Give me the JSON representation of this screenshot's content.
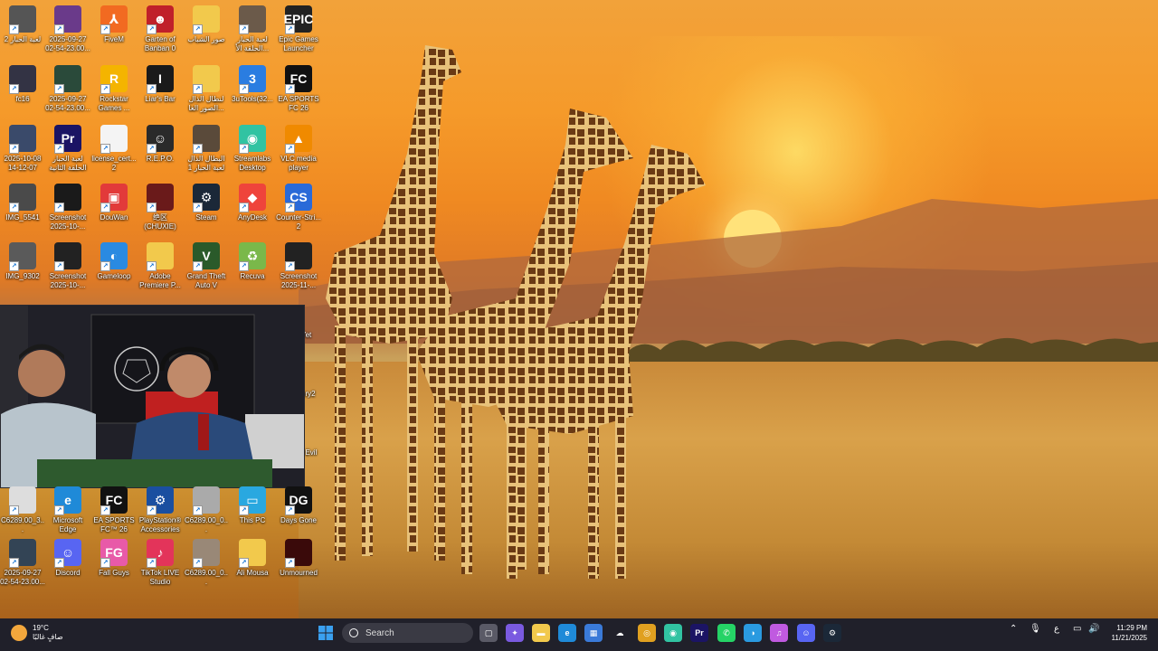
{
  "desktop": {
    "icons": [
      {
        "label": "لعبة الحبار 2",
        "icon": "video-thumbnail-icon",
        "color": "#555555",
        "glyph": ""
      },
      {
        "label": "2025-09-27 02-54-23.00...",
        "icon": "video-thumbnail-icon",
        "color": "#6a3a8a",
        "glyph": ""
      },
      {
        "label": "FiveM",
        "icon": "fivem-icon",
        "color": "#f26a21",
        "glyph": "⅄"
      },
      {
        "label": "Garten of Banban 0",
        "icon": "banban-game-icon",
        "color": "#c0202a",
        "glyph": "☻"
      },
      {
        "label": "صور الشباب",
        "icon": "folder-icon",
        "color": "#f2c94c",
        "glyph": ""
      },
      {
        "label": "لعبة الحبار الحلقة الأ...",
        "icon": "video-thumbnail-icon",
        "color": "#6b5a4a",
        "glyph": ""
      },
      {
        "label": "Epic Games Launcher",
        "icon": "epic-games-icon",
        "color": "#222222",
        "glyph": "EPIC"
      },
      {
        "label": "fc16",
        "icon": "video-thumbnail-icon",
        "color": "#333344",
        "glyph": ""
      },
      {
        "label": "2025-09-27 02-54-23.00...",
        "icon": "video-thumbnail-icon",
        "color": "#2a4a3a",
        "glyph": ""
      },
      {
        "label": "Rockstar Games ...",
        "icon": "rockstar-icon",
        "color": "#f4b400",
        "glyph": "R"
      },
      {
        "label": "Liar's Bar",
        "icon": "liars-bar-icon",
        "color": "#1a1a1a",
        "glyph": "I"
      },
      {
        "label": "لنطال الذال الصور الغا...",
        "icon": "folder-icon",
        "color": "#f2c94c",
        "glyph": ""
      },
      {
        "label": "3uTools(32...",
        "icon": "3utools-icon",
        "color": "#2a7de1",
        "glyph": "3"
      },
      {
        "label": "EA SPORTS FC 26",
        "icon": "ea-fc-icon",
        "color": "#111111",
        "glyph": "FC"
      },
      {
        "label": "2025-10-08 14-12-07",
        "icon": "video-thumbnail-icon",
        "color": "#3a4a6a",
        "glyph": ""
      },
      {
        "label": "لعبة الحبار الحلقة الثانية",
        "icon": "premiere-project-icon",
        "color": "#1b1464",
        "glyph": "Pr"
      },
      {
        "label": "license_cert... 2",
        "icon": "document-icon",
        "color": "#f4f4f4",
        "glyph": ""
      },
      {
        "label": "R.E.P.O.",
        "icon": "repo-game-icon",
        "color": "#2a2a2a",
        "glyph": "☺"
      },
      {
        "label": "البطال الذال لعبة الحبار 1",
        "icon": "video-thumbnail-icon",
        "color": "#5a4a3a",
        "glyph": ""
      },
      {
        "label": "Streamlabs Desktop",
        "icon": "streamlabs-icon",
        "color": "#31c3a2",
        "glyph": "◉"
      },
      {
        "label": "VLC media player",
        "icon": "vlc-icon",
        "color": "#f08a00",
        "glyph": "▲"
      },
      {
        "label": "IMG_5541",
        "icon": "photo-thumbnail-icon",
        "color": "#4a4a4a",
        "glyph": ""
      },
      {
        "label": "Screenshot 2025-10-...",
        "icon": "screenshot-thumbnail-icon",
        "color": "#1a1a1a",
        "glyph": ""
      },
      {
        "label": "DouWan",
        "icon": "douwan-icon",
        "color": "#e23a3a",
        "glyph": "▣"
      },
      {
        "label": "绝区 (CHUXIE)",
        "icon": "chuxie-game-icon",
        "color": "#6a1a1a",
        "glyph": ""
      },
      {
        "label": "Steam",
        "icon": "steam-icon",
        "color": "#1b2838",
        "glyph": "⚙"
      },
      {
        "label": "AnyDesk",
        "icon": "anydesk-icon",
        "color": "#ef443b",
        "glyph": "◆"
      },
      {
        "label": "Counter-Stri... 2",
        "icon": "counter-strike-icon",
        "color": "#2a6ad8",
        "glyph": "CS"
      },
      {
        "label": "IMG_9302",
        "icon": "photo-thumbnail-icon",
        "color": "#5a5a5a",
        "glyph": ""
      },
      {
        "label": "Screenshot 2025-10-...",
        "icon": "screenshot-thumbnail-icon",
        "color": "#222222",
        "glyph": ""
      },
      {
        "label": "Gameloop",
        "icon": "gameloop-icon",
        "color": "#2a8ae1",
        "glyph": "◐"
      },
      {
        "label": "Adobe Premiere P...",
        "icon": "folder-icon",
        "color": "#f2c94c",
        "glyph": ""
      },
      {
        "label": "Grand Theft Auto V",
        "icon": "gta-v-icon",
        "color": "#2a5a2a",
        "glyph": "V"
      },
      {
        "label": "Recuva",
        "icon": "recuva-icon",
        "color": "#7ab84a",
        "glyph": "♻"
      },
      {
        "label": "Screenshot 2025-11-...",
        "icon": "screenshot-thumbnail-icon",
        "color": "#222222",
        "glyph": ""
      }
    ],
    "partial_icons": [
      {
        "label": "Yet"
      },
      {
        "label": "ery2"
      },
      {
        "label": "t Evil"
      }
    ],
    "bottom_icons": [
      {
        "label": "C6289.00_3...",
        "icon": "video-thumbnail-icon",
        "color": "#dddddd",
        "glyph": ""
      },
      {
        "label": "Microsoft Edge",
        "icon": "edge-icon",
        "color": "#1f8ad8",
        "glyph": "e"
      },
      {
        "label": "EA SPORTS FC™ 26",
        "icon": "ea-fc-icon",
        "color": "#111111",
        "glyph": "FC"
      },
      {
        "label": "PlayStation® Accessories",
        "icon": "playstation-icon",
        "color": "#1a4fa0",
        "glyph": "⚙"
      },
      {
        "label": "C6289.00_0...",
        "icon": "video-thumbnail-icon",
        "color": "#aaaaaa",
        "glyph": ""
      },
      {
        "label": "This PC",
        "icon": "this-pc-icon",
        "color": "#29a8e0",
        "glyph": "▭"
      },
      {
        "label": "Days Gone",
        "icon": "days-gone-icon",
        "color": "#111111",
        "glyph": "DG"
      },
      {
        "label": "2025-09-27 02-54-23.00...",
        "icon": "video-thumbnail-icon",
        "color": "#334455",
        "glyph": ""
      },
      {
        "label": "Discord",
        "icon": "discord-icon",
        "color": "#5865f2",
        "glyph": "☺"
      },
      {
        "label": "Fall Guys",
        "icon": "fall-guys-icon",
        "color": "#e85aa8",
        "glyph": "FG"
      },
      {
        "label": "TikTok LIVE Studio",
        "icon": "tiktok-icon",
        "color": "#e3345a",
        "glyph": "♪"
      },
      {
        "label": "C6289.00_0...",
        "icon": "video-thumbnail-icon",
        "color": "#998877",
        "glyph": ""
      },
      {
        "label": "Ali Mousa",
        "icon": "folder-icon",
        "color": "#f2c94c",
        "glyph": ""
      },
      {
        "label": "Unmourned",
        "icon": "unmourned-icon",
        "color": "#3a0a0a",
        "glyph": ""
      }
    ]
  },
  "taskbar": {
    "weather": {
      "temp": "19°C",
      "condition": "صافٍ غالبًا"
    },
    "search_placeholder": "Search",
    "apps": [
      {
        "name": "task-view-icon",
        "color": "#5a5a66",
        "glyph": "▢"
      },
      {
        "name": "copilot-icon",
        "color": "#7a5ae0",
        "glyph": "✦"
      },
      {
        "name": "file-explorer-icon",
        "color": "#f2c94c",
        "glyph": "▬"
      },
      {
        "name": "edge-icon",
        "color": "#1f8ad8",
        "glyph": "e"
      },
      {
        "name": "microsoft-store-icon",
        "color": "#3a7ad8",
        "glyph": "▦"
      },
      {
        "name": "ghost-app-icon",
        "color": "#20202a",
        "glyph": "☁"
      },
      {
        "name": "chrome-icon",
        "color": "#e0a020",
        "glyph": "◎"
      },
      {
        "name": "streamlabs-icon",
        "color": "#31c3a2",
        "glyph": "◉"
      },
      {
        "name": "premiere-icon",
        "color": "#1b1464",
        "glyph": "Pr"
      },
      {
        "name": "whatsapp-icon",
        "color": "#25d366",
        "glyph": "✆"
      },
      {
        "name": "capcut-icon",
        "color": "#2a9ae0",
        "glyph": "◑"
      },
      {
        "name": "itunes-icon",
        "color": "#c05ae0",
        "glyph": "♫"
      },
      {
        "name": "discord-icon",
        "color": "#5865f2",
        "glyph": "☺"
      },
      {
        "name": "steam-icon",
        "color": "#1b2838",
        "glyph": "⚙"
      }
    ],
    "tray": {
      "language": "ع",
      "time": "11:29 PM",
      "date": "11/21/2025"
    }
  }
}
